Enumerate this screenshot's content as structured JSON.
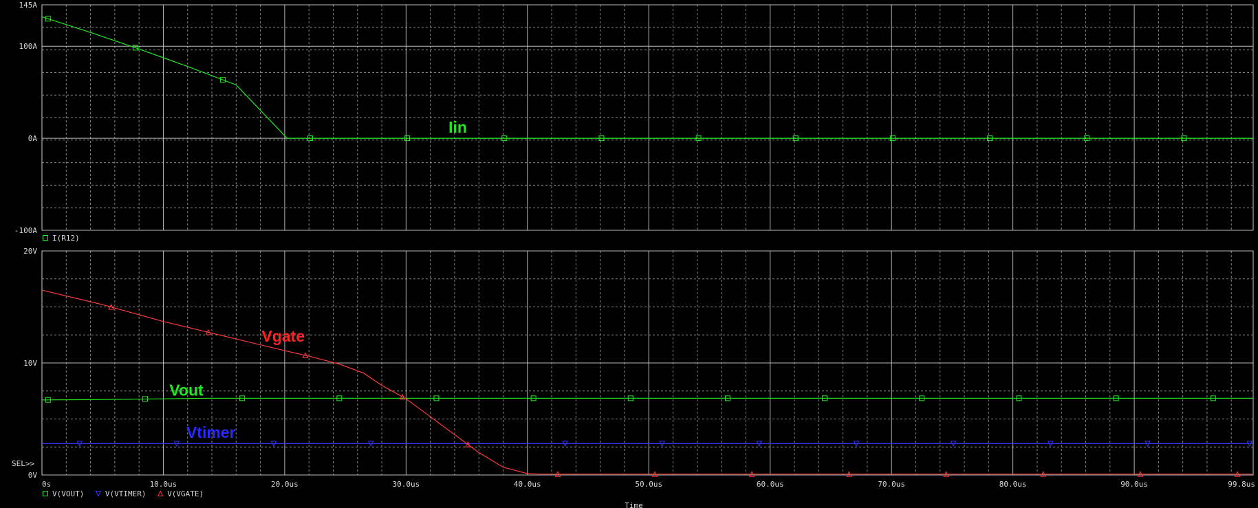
{
  "chart_data": [
    {
      "type": "line",
      "ylim": [
        -100,
        145
      ],
      "xlim": [
        0,
        99.8
      ],
      "grid": true,
      "y_ticks": [
        {
          "value": 145,
          "label": "145A"
        },
        {
          "value": 100,
          "label": "100A"
        },
        {
          "value": 0,
          "label": "0A"
        },
        {
          "value": -100,
          "label": "-100A"
        }
      ],
      "legend": [
        {
          "name": "I(R12)",
          "marker": "square",
          "color": "#22e822"
        }
      ],
      "annotations": [
        {
          "text": "Iin",
          "x": 33.5,
          "y": 6,
          "color": "#22e822"
        }
      ],
      "series": [
        {
          "name": "I(R12)",
          "color": "#22e822",
          "marker": "square",
          "x": [
            0,
            4,
            8,
            12,
            16,
            20.2,
            25,
            30,
            35,
            40,
            45,
            50,
            55,
            60,
            65,
            70,
            75,
            80,
            85,
            90,
            95,
            99.8
          ],
          "y": [
            132,
            115,
            97,
            78,
            58,
            0,
            0,
            0,
            0,
            0,
            0,
            0,
            0,
            0,
            0,
            0,
            0,
            0,
            0,
            0,
            0,
            0
          ],
          "marker_x": [
            0.5,
            7.7,
            14.9,
            22.1,
            30.1,
            38.1,
            46.1,
            54.1,
            62.1,
            70.1,
            78.1,
            86.1,
            94.1
          ]
        }
      ]
    },
    {
      "type": "line",
      "ylim": [
        0,
        20
      ],
      "xlim": [
        0,
        99.8
      ],
      "grid": true,
      "y_ticks": [
        {
          "value": 20,
          "label": "20V"
        },
        {
          "value": 10,
          "label": "10V"
        },
        {
          "value": 0,
          "label": "0V"
        }
      ],
      "x_ticks": [
        {
          "value": 0,
          "label": "0s"
        },
        {
          "value": 10,
          "label": "10.0us"
        },
        {
          "value": 20,
          "label": "20.0us"
        },
        {
          "value": 30,
          "label": "30.0us"
        },
        {
          "value": 40,
          "label": "40.0us"
        },
        {
          "value": 50,
          "label": "50.0us"
        },
        {
          "value": 60,
          "label": "60.0us"
        },
        {
          "value": 70,
          "label": "70.0us"
        },
        {
          "value": 80,
          "label": "80.0us"
        },
        {
          "value": 90,
          "label": "90.0us"
        },
        {
          "value": 99.8,
          "label": "99.8us"
        }
      ],
      "xlabel": "Time",
      "sel_label": "SEL>>",
      "legend": [
        {
          "name": "V(VOUT)",
          "marker": "square",
          "color": "#22e822"
        },
        {
          "name": "V(VTIMER)",
          "marker": "triangle-down",
          "color": "#3636ff"
        },
        {
          "name": "V(VGATE)",
          "marker": "triangle-up",
          "color": "#ff3a3a"
        }
      ],
      "annotations": [
        {
          "text": "Vgate",
          "x": 18.1,
          "y": 11.9,
          "color": "#ff2222"
        },
        {
          "text": "Vout",
          "x": 10.5,
          "y": 7.1,
          "color": "#22e822"
        },
        {
          "text": "Vtimer",
          "x": 11.9,
          "y": 3.3,
          "color": "#2a2aff"
        }
      ],
      "series": [
        {
          "name": "V(VOUT)",
          "color": "#22e822",
          "marker": "square",
          "x": [
            0,
            3,
            10,
            14,
            18,
            99.8
          ],
          "y": [
            6.7,
            6.72,
            6.8,
            6.85,
            6.85,
            6.85
          ],
          "marker_x": [
            0.5,
            8.5,
            16.5,
            24.5,
            32.5,
            40.5,
            48.5,
            56.5,
            64.5,
            72.5,
            80.5,
            88.5,
            96.5
          ]
        },
        {
          "name": "V(VTIMER)",
          "color": "#3636ff",
          "marker": "triangle-down",
          "x": [
            0,
            99.8
          ],
          "y": [
            2.8,
            2.8
          ],
          "marker_x": [
            3.1,
            11.1,
            19.1,
            27.1,
            43.1,
            51.1,
            59.1,
            67.1,
            75.1,
            83.1,
            91.1,
            99.5
          ]
        },
        {
          "name": "V(VGATE)",
          "color": "#ff3a3a",
          "marker": "triangle-up",
          "x": [
            0,
            5,
            10,
            15,
            20,
            22,
            24.5,
            26.5,
            28,
            30,
            32,
            34,
            36,
            38,
            40,
            41,
            99.8
          ],
          "y": [
            16.5,
            15.2,
            13.7,
            12.4,
            11.1,
            10.6,
            9.9,
            9.1,
            8.0,
            6.8,
            5.2,
            3.6,
            2.0,
            0.7,
            0.12,
            0.08,
            0.08
          ],
          "marker_x": [
            5.7,
            13.7,
            21.7,
            29.7,
            35.1,
            42.5,
            50.5,
            58.5,
            66.5,
            74.5,
            82.5,
            90.5,
            98.5
          ]
        }
      ]
    }
  ]
}
